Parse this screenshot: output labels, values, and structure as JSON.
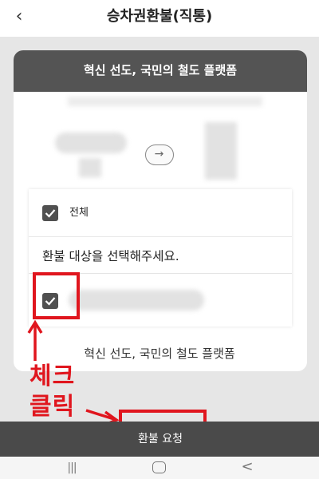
{
  "header": {
    "back_icon": "‹",
    "title": "승차권환불(직통)"
  },
  "card": {
    "header_text": "혁신 선도, 국민의 철도 플랫폼",
    "route_arrow_icon": "→"
  },
  "selection": {
    "all_label": "전체",
    "instruction": "환불 대상을 선택해주세요.",
    "all_checked": true,
    "item_checked": true
  },
  "footer_text": "혁신 선도, 국민의 철도 플랫폼",
  "annotation": {
    "line1": "체크",
    "line2": "클릭",
    "color": "#e0161e"
  },
  "bottom_bar": {
    "refund_button": "환불 요청"
  },
  "nav": {
    "recent_icon": "|||",
    "back_icon": "<"
  }
}
